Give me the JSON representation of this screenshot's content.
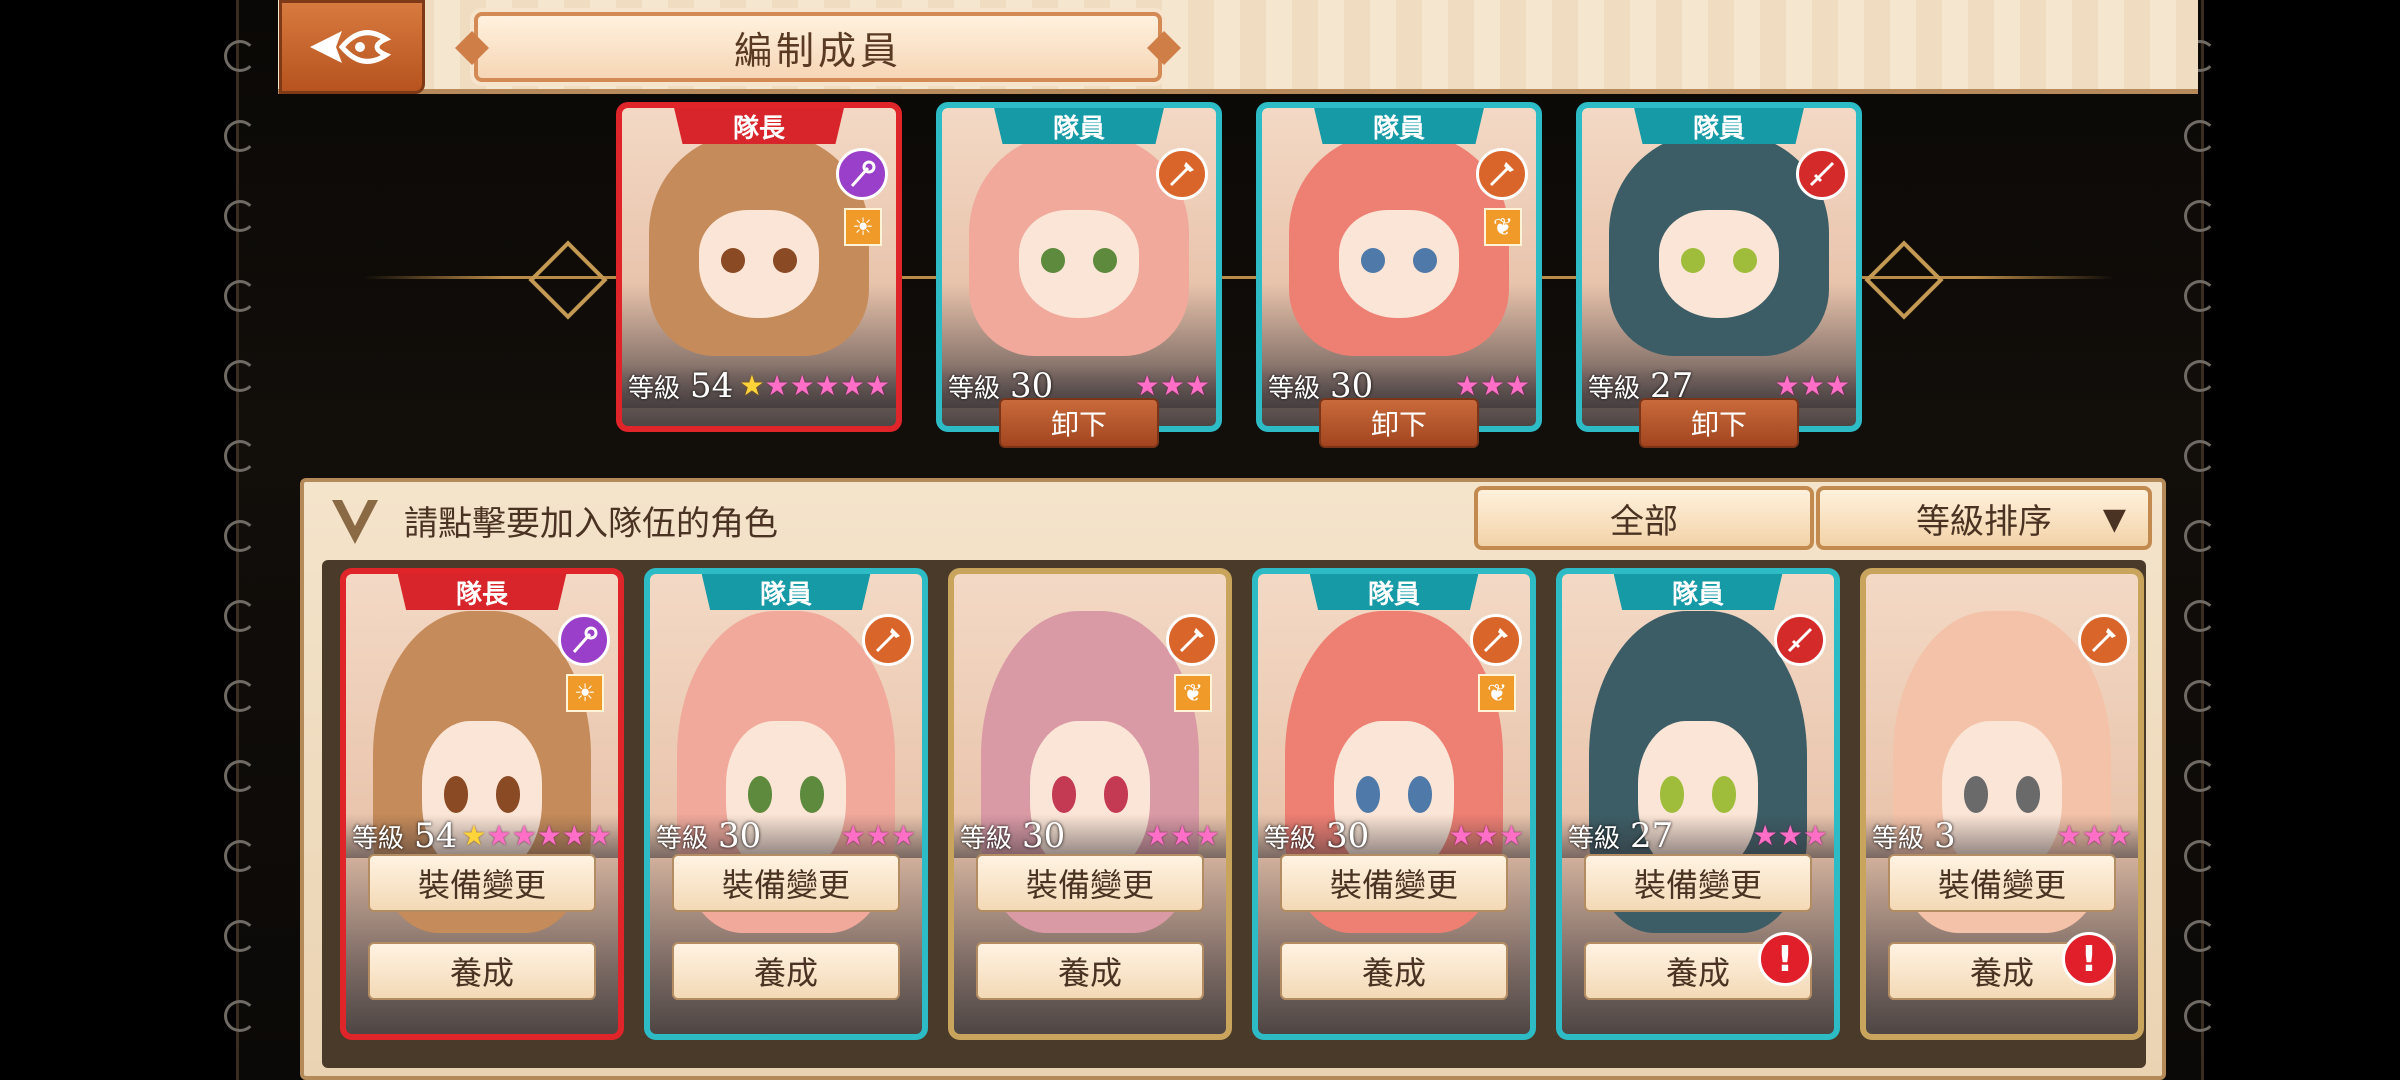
{
  "header": {
    "title": "編制成員"
  },
  "labels": {
    "level": "等級",
    "unequip": "卸下",
    "equip_change": "裝備變更",
    "train": "養成",
    "prompt": "請點擊要加入隊伍的角色",
    "filter": "全部",
    "sort": "等級排序",
    "sort_arrow": "▼",
    "alert": "!"
  },
  "team": [
    {
      "role": "隊長",
      "level": "54",
      "stars": 6,
      "gold_first": true,
      "type": "captain",
      "weapon": "staff-icon",
      "element": "☀",
      "hair": "#c58b5a",
      "eyes": "#8a4a24"
    },
    {
      "role": "隊員",
      "level": "30",
      "stars": 3,
      "gold_first": false,
      "type": "member",
      "weapon": "spear-icon",
      "element": "",
      "hair": "#f0a99b",
      "eyes": "#5d8a3c"
    },
    {
      "role": "隊員",
      "level": "30",
      "stars": 3,
      "gold_first": false,
      "type": "member",
      "weapon": "spear-icon",
      "element": "❦",
      "hair": "#ee7f73",
      "eyes": "#4f79a8"
    },
    {
      "role": "隊員",
      "level": "27",
      "stars": 3,
      "gold_first": false,
      "type": "member",
      "weapon": "rapier-icon",
      "element": "",
      "hair": "#3c5d66",
      "eyes": "#9fbd3b"
    }
  ],
  "roster": [
    {
      "role": "隊長",
      "level": "54",
      "stars": 6,
      "gold_first": true,
      "type": "captain",
      "weapon": "staff-icon",
      "element": "☀",
      "hair": "#c58b5a",
      "eyes": "#8a4a24",
      "alert": false
    },
    {
      "role": "隊員",
      "level": "30",
      "stars": 3,
      "gold_first": false,
      "type": "member",
      "weapon": "spear-icon",
      "element": "",
      "hair": "#f0a99b",
      "eyes": "#5d8a3c",
      "alert": false
    },
    {
      "role": "",
      "level": "30",
      "stars": 3,
      "gold_first": false,
      "type": "none",
      "weapon": "spear-icon",
      "element": "❦",
      "hair": "#d99aa6",
      "eyes": "#c43a53",
      "alert": false
    },
    {
      "role": "隊員",
      "level": "30",
      "stars": 3,
      "gold_first": false,
      "type": "member",
      "weapon": "spear-icon",
      "element": "❦",
      "hair": "#ee7f73",
      "eyes": "#4f79a8",
      "alert": false
    },
    {
      "role": "隊員",
      "level": "27",
      "stars": 3,
      "gold_first": false,
      "type": "member",
      "weapon": "rapier-icon",
      "element": "",
      "hair": "#3c5d66",
      "eyes": "#9fbd3b",
      "alert": true
    },
    {
      "role": "",
      "level": "3",
      "stars": 3,
      "gold_first": false,
      "type": "none",
      "weapon": "spear-icon",
      "element": "",
      "hair": "#f3c2a8",
      "eyes": "#6a6a6a",
      "alert": true
    }
  ],
  "colors": {
    "captain_border": "#e0252a",
    "member_border": "#2dbcc6",
    "star_pink": "#ff6fc7",
    "star_gold": "#ffd43b",
    "weapon_staff": "#9a3fc9",
    "weapon_spear": "#d9652a",
    "weapon_rapier": "#d42a2a"
  }
}
